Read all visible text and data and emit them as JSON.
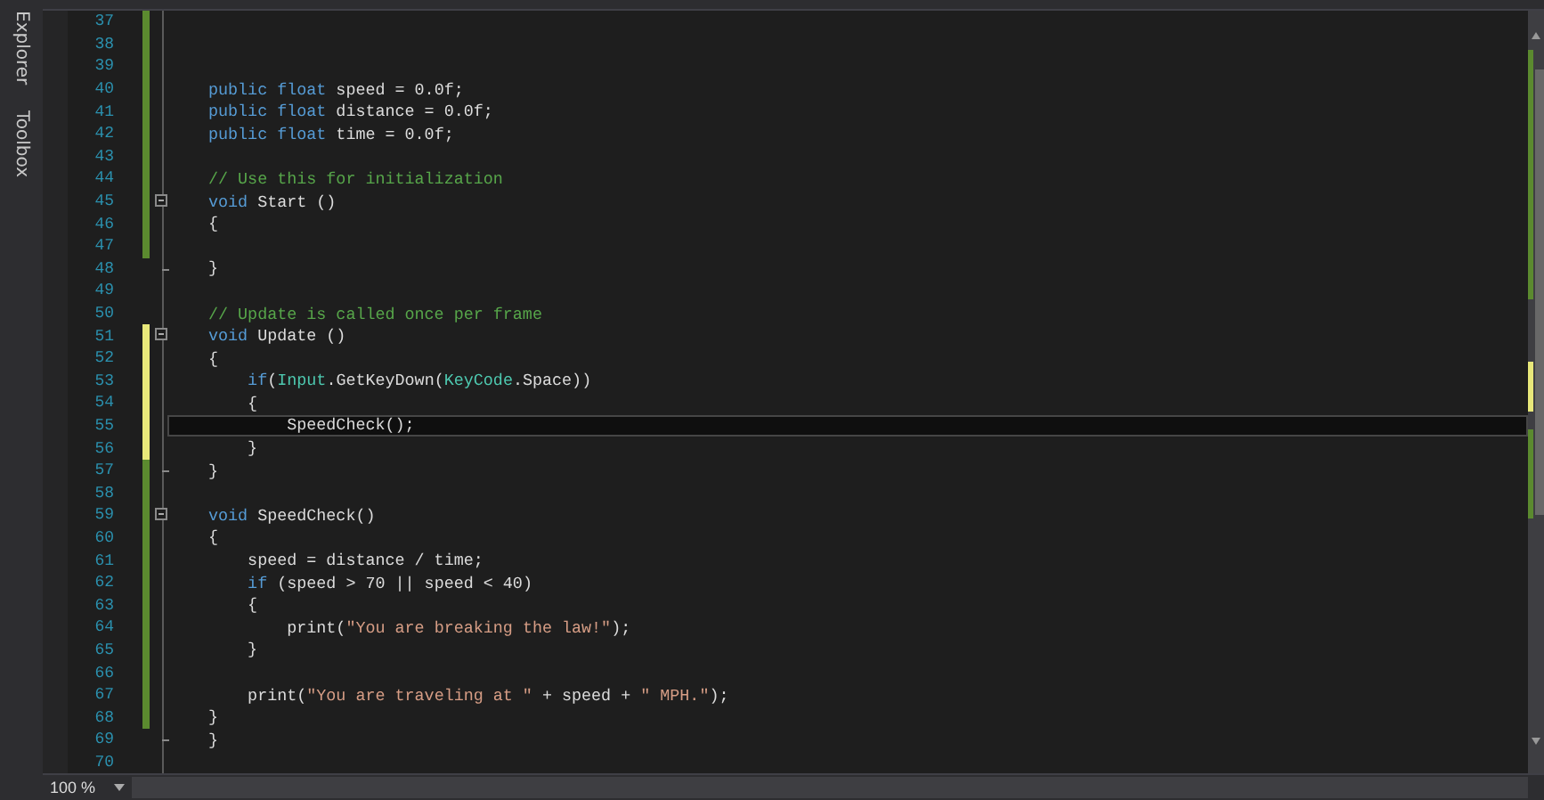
{
  "side_tabs": [
    {
      "label": "Explorer"
    },
    {
      "label": "Toolbox"
    }
  ],
  "lines": [
    {
      "number": "37",
      "changed": true,
      "saved": true,
      "kind": "plain",
      "current": false
    },
    {
      "number": "38",
      "changed": true,
      "saved": true,
      "kind": "plain",
      "current": false
    },
    {
      "number": "39",
      "changed": true,
      "saved": true,
      "kind": "plain",
      "current": false
    },
    {
      "number": "40",
      "changed": true,
      "saved": true,
      "kind": "plain",
      "current": false,
      "tokens": [
        {
          "kind": "keyword",
          "text": "public float"
        },
        {
          "kind": "plain",
          "text": " speed = 0.0f;"
        }
      ]
    },
    {
      "number": "41",
      "changed": true,
      "saved": true,
      "kind": "plain",
      "current": false,
      "tokens": [
        {
          "kind": "keyword",
          "text": "public float"
        },
        {
          "kind": "plain",
          "text": " distance = 0.0f;"
        }
      ]
    },
    {
      "number": "42",
      "changed": true,
      "saved": true,
      "kind": "plain",
      "current": false,
      "tokens": [
        {
          "kind": "keyword",
          "text": "public float"
        },
        {
          "kind": "plain",
          "text": " time = 0.0f;"
        }
      ]
    },
    {
      "number": "43",
      "changed": true,
      "saved": true,
      "kind": "plain",
      "current": false
    },
    {
      "number": "44",
      "changed": true,
      "saved": true,
      "kind": "plain",
      "current": false,
      "tokens": [
        {
          "kind": "comment",
          "text": "// Use this for initialization"
        }
      ]
    },
    {
      "number": "45",
      "changed": true,
      "saved": true,
      "kind": "fold_start",
      "current": false,
      "tokens": [
        {
          "kind": "keyword",
          "text": "void"
        },
        {
          "kind": "plain",
          "text": " Start ()"
        }
      ]
    },
    {
      "number": "46",
      "changed": true,
      "saved": true,
      "kind": "plain",
      "current": false,
      "tokens": [
        {
          "kind": "plain",
          "text": "{"
        }
      ]
    },
    {
      "number": "47",
      "changed": true,
      "saved": true,
      "kind": "plain",
      "current": false
    },
    {
      "number": "48",
      "changed": false,
      "kind": "fold_end",
      "current": false,
      "tokens": [
        {
          "kind": "plain",
          "text": "}"
        }
      ]
    },
    {
      "number": "49",
      "changed": false,
      "kind": "plain",
      "current": false
    },
    {
      "number": "50",
      "changed": false,
      "kind": "plain",
      "current": false,
      "tokens": [
        {
          "kind": "comment",
          "text": "// Update is called once per frame"
        }
      ]
    },
    {
      "number": "51",
      "changed": true,
      "saved": false,
      "kind": "fold_start",
      "current": false,
      "tokens": [
        {
          "kind": "keyword",
          "text": "void"
        },
        {
          "kind": "plain",
          "text": " Update ()"
        }
      ]
    },
    {
      "number": "52",
      "changed": true,
      "saved": false,
      "kind": "plain",
      "current": false,
      "tokens": [
        {
          "kind": "plain",
          "text": "{"
        }
      ]
    },
    {
      "number": "53",
      "changed": true,
      "saved": false,
      "kind": "plain",
      "current": false,
      "tokens": [
        {
          "kind": "keyword",
          "text": "    if"
        },
        {
          "kind": "plain",
          "text": "("
        },
        {
          "kind": "type",
          "text": "Input"
        },
        {
          "kind": "plain",
          "text": ".GetKeyDown("
        },
        {
          "kind": "type",
          "text": "KeyCode"
        },
        {
          "kind": "plain",
          "text": ".Space))"
        }
      ]
    },
    {
      "number": "54",
      "changed": true,
      "saved": false,
      "kind": "plain",
      "current": false,
      "tokens": [
        {
          "kind": "plain",
          "text": "    {"
        }
      ]
    },
    {
      "number": "55",
      "changed": true,
      "saved": false,
      "kind": "plain",
      "current": true,
      "tokens": [
        {
          "kind": "plain",
          "text": "        SpeedCheck();"
        }
      ]
    },
    {
      "number": "56",
      "changed": true,
      "saved": false,
      "kind": "plain",
      "current": false,
      "tokens": [
        {
          "kind": "plain",
          "text": "    }"
        }
      ]
    },
    {
      "number": "57",
      "changed": true,
      "saved": true,
      "kind": "fold_end",
      "current": false,
      "tokens": [
        {
          "kind": "plain",
          "text": "}"
        }
      ]
    },
    {
      "number": "58",
      "changed": true,
      "saved": true,
      "kind": "plain",
      "current": false
    },
    {
      "number": "59",
      "changed": true,
      "saved": true,
      "kind": "fold_start",
      "current": false,
      "tokens": [
        {
          "kind": "keyword",
          "text": "void"
        },
        {
          "kind": "plain",
          "text": " SpeedCheck()"
        }
      ]
    },
    {
      "number": "60",
      "changed": true,
      "saved": true,
      "kind": "plain",
      "current": false,
      "tokens": [
        {
          "kind": "plain",
          "text": "{"
        }
      ]
    },
    {
      "number": "61",
      "changed": true,
      "saved": true,
      "kind": "plain",
      "current": false,
      "tokens": [
        {
          "kind": "plain",
          "text": "    speed = distance / time;"
        }
      ]
    },
    {
      "number": "62",
      "changed": true,
      "saved": true,
      "kind": "plain",
      "current": false,
      "tokens": [
        {
          "kind": "keyword",
          "text": "    if"
        },
        {
          "kind": "plain",
          "text": " (speed > 70 || speed < 40)"
        }
      ]
    },
    {
      "number": "63",
      "changed": true,
      "saved": true,
      "kind": "plain",
      "current": false,
      "tokens": [
        {
          "kind": "plain",
          "text": "    {"
        }
      ]
    },
    {
      "number": "64",
      "changed": true,
      "saved": true,
      "kind": "plain",
      "current": false,
      "tokens": [
        {
          "kind": "plain",
          "text": "        print("
        },
        {
          "kind": "string",
          "text": "\"You are breaking the law!\""
        },
        {
          "kind": "plain",
          "text": ");"
        }
      ]
    },
    {
      "number": "65",
      "changed": true,
      "saved": true,
      "kind": "plain",
      "current": false,
      "tokens": [
        {
          "kind": "plain",
          "text": "    }"
        }
      ]
    },
    {
      "number": "66",
      "changed": true,
      "saved": true,
      "kind": "plain",
      "current": false
    },
    {
      "number": "67",
      "changed": true,
      "saved": true,
      "kind": "plain",
      "current": false,
      "tokens": [
        {
          "kind": "plain",
          "text": "    print("
        },
        {
          "kind": "string",
          "text": "\"You are traveling at \""
        },
        {
          "kind": "plain",
          "text": " + speed + "
        },
        {
          "kind": "string",
          "text": "\" MPH.\""
        },
        {
          "kind": "plain",
          "text": ");"
        }
      ]
    },
    {
      "number": "68",
      "changed": true,
      "saved": true,
      "kind": "plain",
      "current": false,
      "tokens": [
        {
          "kind": "plain",
          "text": "}"
        }
      ]
    },
    {
      "number": "69",
      "changed": false,
      "kind": "fold_end",
      "current": false,
      "tokens": [
        {
          "kind": "plain",
          "text": "}"
        }
      ]
    },
    {
      "number": "70",
      "changed": false,
      "kind": "plain",
      "current": false
    }
  ],
  "zoom": {
    "value": "100 %"
  }
}
